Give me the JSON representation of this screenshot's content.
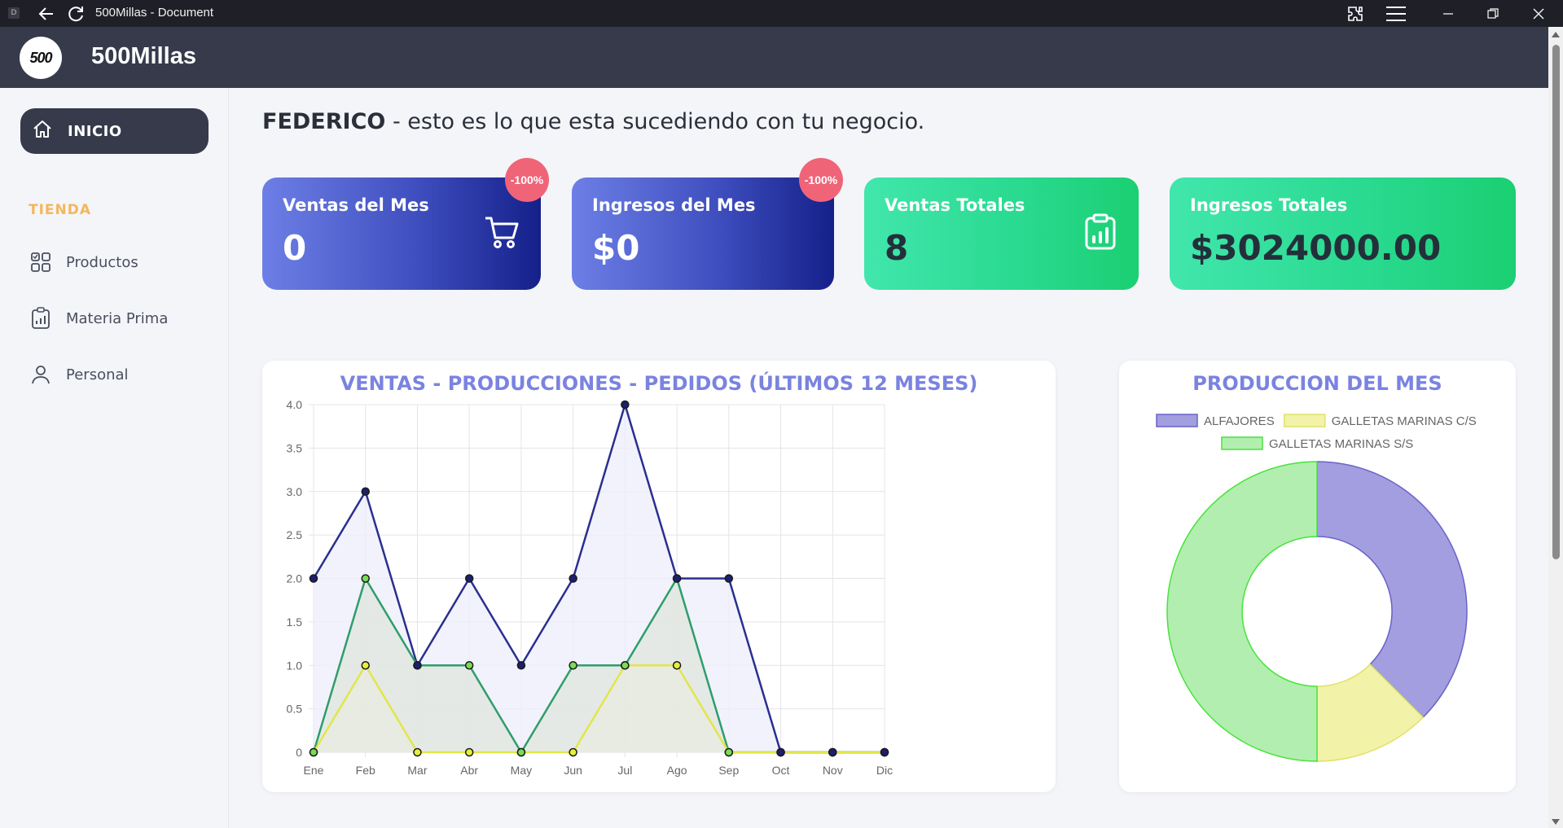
{
  "window": {
    "title": "500Millas - Document",
    "badge": "D"
  },
  "header": {
    "logo_text": "500",
    "brand": "500Millas"
  },
  "sidebar": {
    "home": {
      "label": "INICIO",
      "icon": "home-icon"
    },
    "section": "TIENDA",
    "items": [
      {
        "label": "Productos",
        "icon": "grid-icon"
      },
      {
        "label": "Materia Prima",
        "icon": "clipboard-chart-icon"
      },
      {
        "label": "Personal",
        "icon": "user-icon"
      }
    ]
  },
  "greeting": {
    "name": "FEDERICO",
    "text": " - esto es lo que esta sucediendo con tu negocio."
  },
  "cards": [
    {
      "title": "Ventas del Mes",
      "value": "0",
      "badge": "-100%",
      "icon": "cart-icon"
    },
    {
      "title": "Ingresos del Mes",
      "value": "$0",
      "badge": "-100%"
    },
    {
      "title": "Ventas Totales",
      "value": "8",
      "icon": "clipboard-chart-icon"
    },
    {
      "title": "Ingresos Totales",
      "value": "$3024000.00"
    }
  ],
  "line_panel": {
    "title": "VENTAS - PRODUCCIONES - PEDIDOS (ÚLTIMOS 12 MESES)"
  },
  "donut_panel": {
    "title": "PRODUCCION DEL MES"
  },
  "colors": {
    "accent_dark": "#363a4b",
    "section": "#f4b75a",
    "badge": "#f06478",
    "navy": "#2a2f8f",
    "green_series": "#2e9e6a",
    "yellow_series": "#e1e64a"
  },
  "chart_data": [
    {
      "type": "line",
      "title": "VENTAS - PRODUCCIONES - PEDIDOS (ÚLTIMOS 12 MESES)",
      "categories": [
        "Ene",
        "Feb",
        "Mar",
        "Abr",
        "May",
        "Jun",
        "Jul",
        "Ago",
        "Sep",
        "Oct",
        "Nov",
        "Dic"
      ],
      "yticks": [
        "0",
        "0.5",
        "1.0",
        "1.5",
        "2.0",
        "2.5",
        "3.0",
        "3.5",
        "4.0"
      ],
      "ylim": [
        0,
        4
      ],
      "grid": true,
      "series": [
        {
          "values": [
            2,
            3,
            1,
            2,
            1,
            2,
            4,
            2,
            2,
            0,
            0,
            0
          ],
          "color": "#2a2f8f",
          "fill": "#ecedfb",
          "point_color": "#1c1f6e"
        },
        {
          "values": [
            0,
            2,
            1,
            1,
            0,
            1,
            1,
            2,
            0,
            0,
            0,
            0
          ],
          "color": "#2e9e6a",
          "fill": "#dfe6dd",
          "point_color": "#7bdc55"
        },
        {
          "values": [
            0,
            1,
            0,
            0,
            0,
            0,
            1,
            1,
            0,
            0,
            0,
            0
          ],
          "color": "#e1e64a",
          "fill": "#e9ebdf",
          "point_color": "#e8ef3a"
        }
      ]
    },
    {
      "type": "pie",
      "title": "PRODUCCION DEL MES",
      "legend": [
        {
          "name": "ALFAJORES",
          "value": 37.5,
          "color": "#a29ee0",
          "border": "#6a63c7"
        },
        {
          "name": "GALLETAS MARINAS C/S",
          "value": 12.5,
          "color": "#f2f2a8",
          "border": "#dfe36a"
        },
        {
          "name": "GALLETAS MARINAS S/S",
          "value": 50,
          "color": "#b2eeaf",
          "border": "#47e33a"
        }
      ]
    }
  ]
}
